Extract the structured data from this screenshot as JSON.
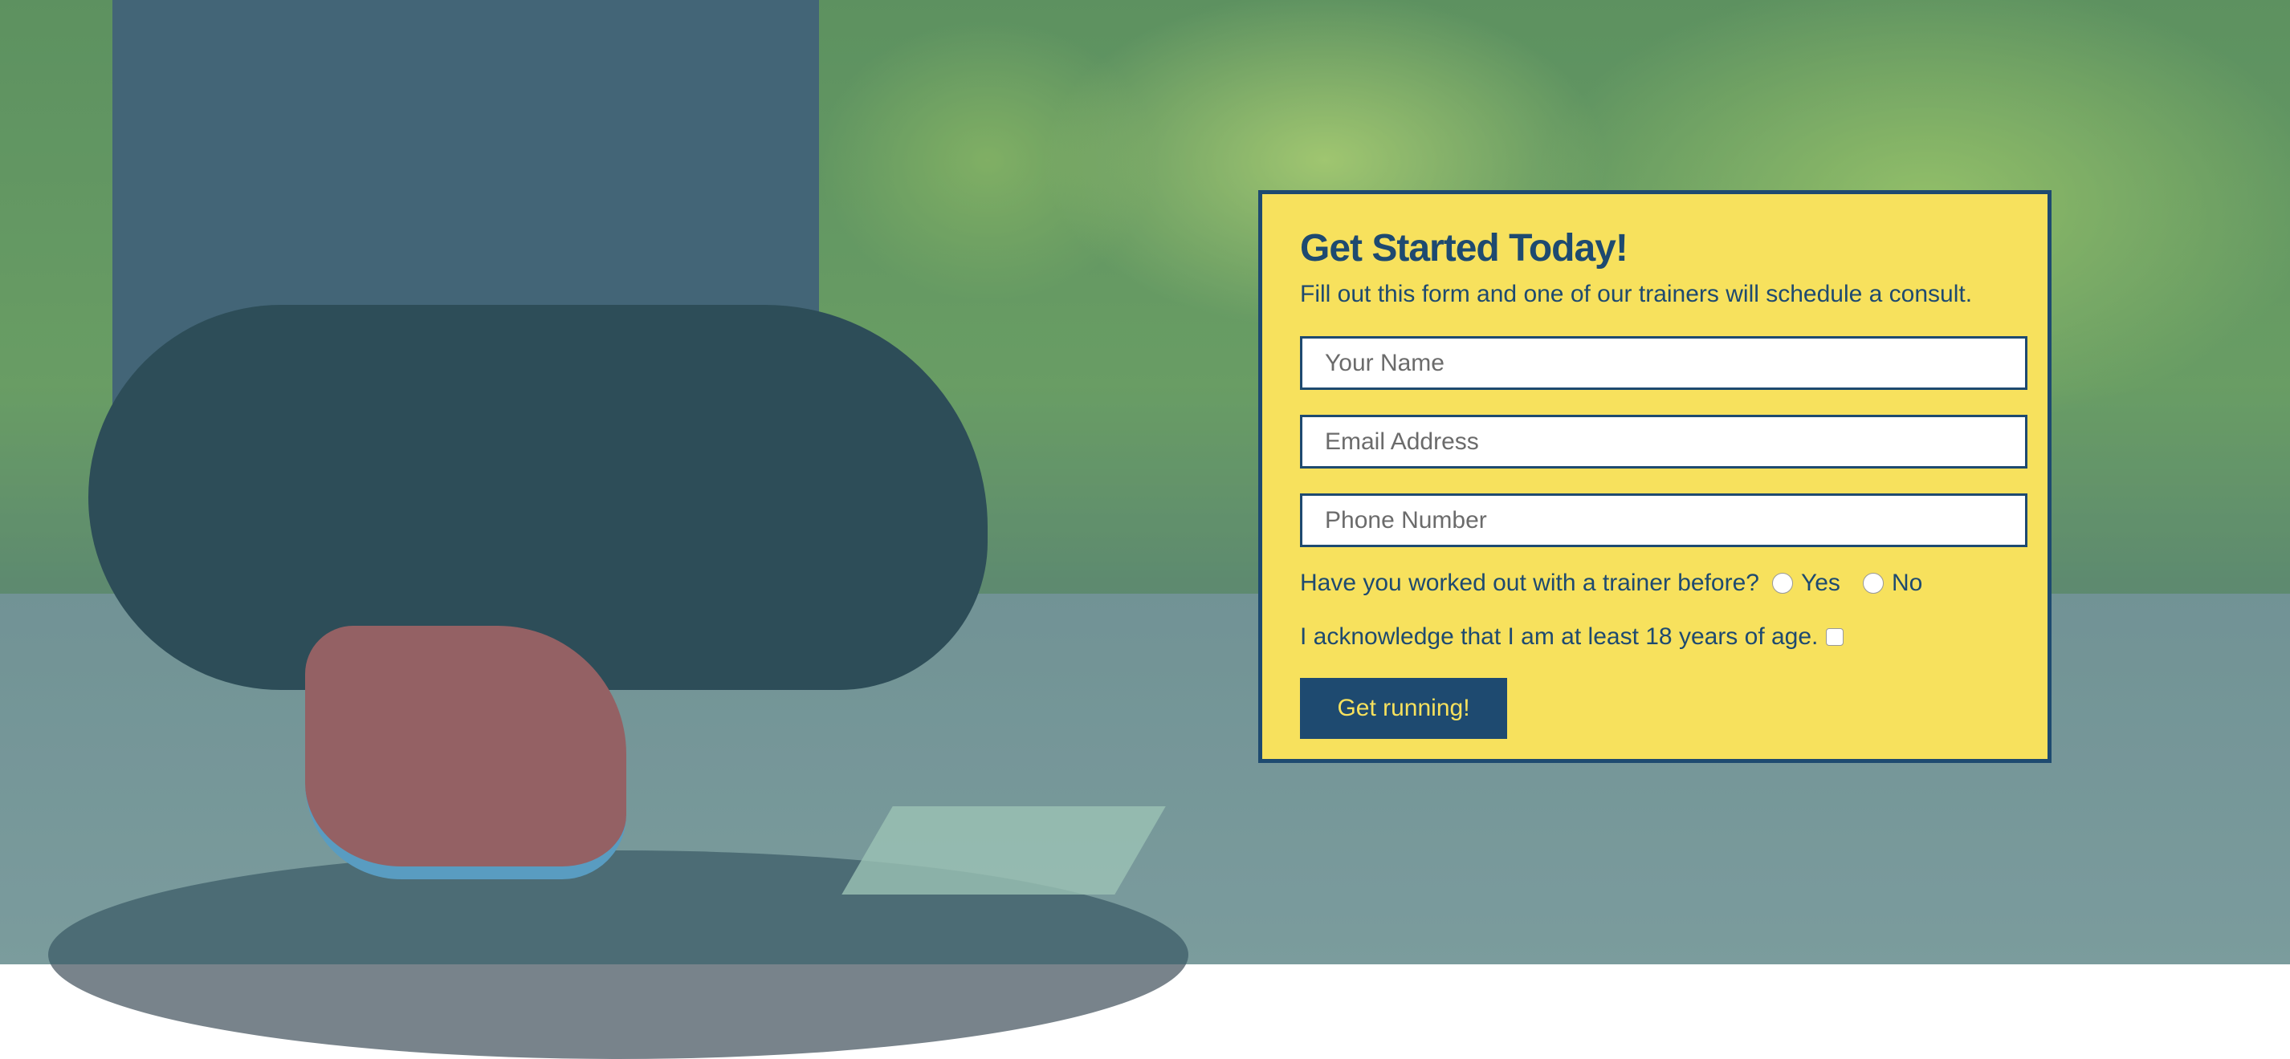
{
  "form": {
    "title": "Get Started Today!",
    "subtitle": "Fill out this form and one of our trainers will schedule a consult.",
    "name_placeholder": "Your Name",
    "email_placeholder": "Email Address",
    "phone_placeholder": "Phone Number",
    "trainer_question": "Have you worked out with a trainer before?",
    "option_yes": "Yes",
    "option_no": "No",
    "age_ack": "I acknowledge that I am at least 18 years of age.",
    "submit_label": "Get running!"
  },
  "colors": {
    "accent": "#1e4a70",
    "form_bg": "#f7e15d"
  }
}
